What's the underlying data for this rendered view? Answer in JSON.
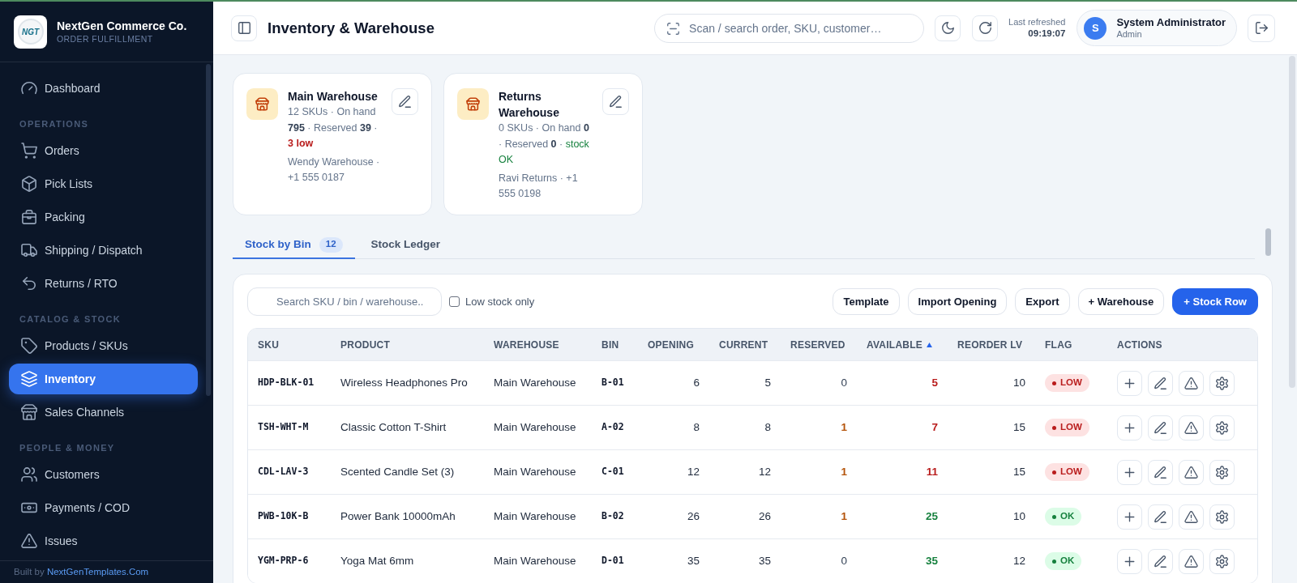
{
  "sidebar": {
    "logo_text": "NGT",
    "brand_name": "NextGen Commerce Co.",
    "brand_tagline": "ORDER FULFILLMENT",
    "groups": [
      {
        "items": [
          {
            "label": "Dashboard",
            "selected": false
          }
        ]
      },
      {
        "heading": "OPERATIONS",
        "items": [
          {
            "label": "Orders",
            "selected": false
          },
          {
            "label": "Pick Lists",
            "selected": false
          },
          {
            "label": "Packing",
            "selected": false
          },
          {
            "label": "Shipping / Dispatch",
            "selected": false
          },
          {
            "label": "Returns / RTO",
            "selected": false
          }
        ]
      },
      {
        "heading": "CATALOG & STOCK",
        "items": [
          {
            "label": "Products / SKUs",
            "selected": false
          },
          {
            "label": "Inventory",
            "selected": true
          },
          {
            "label": "Sales Channels",
            "selected": false
          }
        ]
      },
      {
        "heading": "PEOPLE & MONEY",
        "items": [
          {
            "label": "Customers",
            "selected": false
          },
          {
            "label": "Payments / COD",
            "selected": false
          },
          {
            "label": "Issues",
            "selected": false
          }
        ]
      }
    ],
    "footer": {
      "prefix": "Built by",
      "link": "NextGenTemplates.Com"
    }
  },
  "header": {
    "title": "Inventory & Warehouse",
    "search": {
      "placeholder": "Scan / search order, SKU, customer…"
    },
    "refresh_label": "Last refreshed",
    "refresh_time": "09:19:07",
    "user": {
      "initial": "S",
      "name": "System Administrator",
      "role": "Admin"
    }
  },
  "warehouses": [
    {
      "name": "Main Warehouse",
      "stats": "12 SKUs · On hand **795** · Reserved **39** ·",
      "status": {
        "kind": "low",
        "text": "3 low"
      },
      "contact": "Wendy Warehouse · +1 555 0187"
    },
    {
      "name": "Returns Warehouse",
      "stats": "0 SKUs · On hand **0** · Reserved **0** ·",
      "status": {
        "kind": "ok",
        "text": "stock OK"
      },
      "contact": "Ravi Returns · +1 555 0198"
    }
  ],
  "tabs": [
    {
      "label": "Stock by Bin",
      "count": "12",
      "selected": true
    },
    {
      "label": "Stock Ledger",
      "selected": false
    }
  ],
  "toolbar": {
    "search": {
      "placeholder": "Search SKU / bin / warehouse.."
    },
    "low_stock_only": {
      "label": "Low stock only",
      "checked": false
    },
    "buttons": [
      {
        "label": "Template",
        "kind": "secondary"
      },
      {
        "label": "Import Opening",
        "kind": "secondary"
      },
      {
        "label": "Export",
        "kind": "secondary"
      },
      {
        "label": "+ Warehouse",
        "kind": "secondary"
      },
      {
        "label": "+ Stock Row",
        "kind": "primary"
      }
    ]
  },
  "table": {
    "columns": [
      {
        "label": "SKU",
        "sorted": false
      },
      {
        "label": "PRODUCT",
        "sorted": false
      },
      {
        "label": "WAREHOUSE",
        "sorted": false
      },
      {
        "label": "BIN",
        "sorted": false
      },
      {
        "label": "OPENING",
        "sorted": false
      },
      {
        "label": "CURRENT",
        "sorted": false
      },
      {
        "label": "RESERVED",
        "sorted": false
      },
      {
        "label": "AVAILABLE",
        "sorted": true
      },
      {
        "label": "REORDER LV",
        "sorted": false
      },
      {
        "label": "FLAG",
        "sorted": false
      },
      {
        "label": "ACTIONS",
        "sorted": false
      }
    ],
    "rows": [
      {
        "sku": "HDP-BLK-01",
        "product": "Wireless Headphones Pro",
        "warehouse": "Main Warehouse",
        "bin": "B-01",
        "opening": "6",
        "current": "5",
        "reserved": "0",
        "reserved_highlighted": false,
        "available": "5",
        "reorder_level": "10",
        "kind": "low",
        "flag": "LOW"
      },
      {
        "sku": "TSH-WHT-M",
        "product": "Classic Cotton T-Shirt",
        "warehouse": "Main Warehouse",
        "bin": "A-02",
        "opening": "8",
        "current": "8",
        "reserved": "1",
        "reserved_highlighted": true,
        "available": "7",
        "reorder_level": "15",
        "kind": "low",
        "flag": "LOW"
      },
      {
        "sku": "CDL-LAV-3",
        "product": "Scented Candle Set (3)",
        "warehouse": "Main Warehouse",
        "bin": "C-01",
        "opening": "12",
        "current": "12",
        "reserved": "1",
        "reserved_highlighted": true,
        "available": "11",
        "reorder_level": "15",
        "kind": "low",
        "flag": "LOW"
      },
      {
        "sku": "PWB-10K-B",
        "product": "Power Bank 10000mAh",
        "warehouse": "Main Warehouse",
        "bin": "B-02",
        "opening": "26",
        "current": "26",
        "reserved": "1",
        "reserved_highlighted": true,
        "available": "25",
        "reorder_level": "10",
        "kind": "ok",
        "flag": "OK"
      },
      {
        "sku": "YGM-PRP-6",
        "product": "Yoga Mat 6mm",
        "warehouse": "Main Warehouse",
        "bin": "D-01",
        "opening": "35",
        "current": "35",
        "reserved": "0",
        "reserved_highlighted": false,
        "available": "35",
        "reorder_level": "12",
        "kind": "ok",
        "flag": "OK"
      }
    ]
  }
}
